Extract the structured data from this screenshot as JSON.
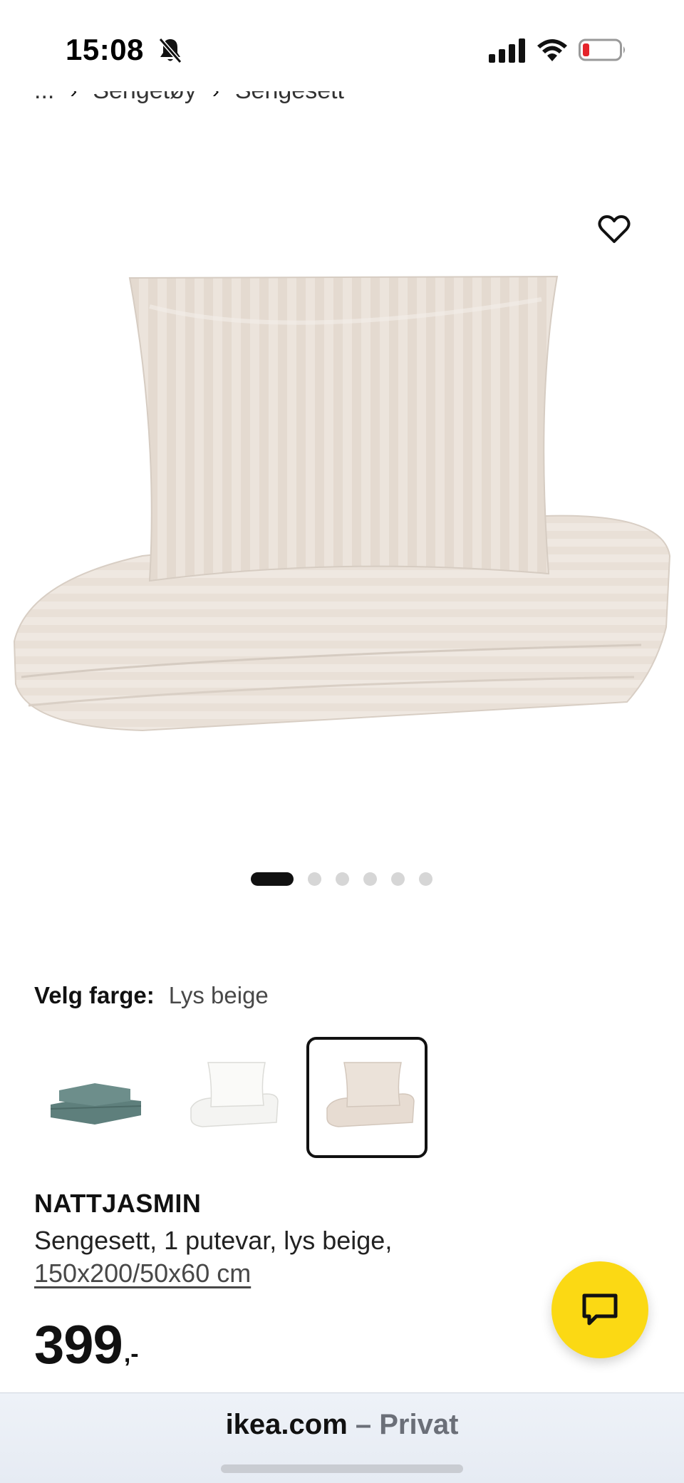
{
  "status_bar": {
    "time": "15:08",
    "icons": [
      "bell-slash-icon",
      "cellular-signal-icon",
      "wifi-icon",
      "battery-low-icon"
    ]
  },
  "breadcrumb": {
    "items": [
      "...",
      "Sengetøy",
      "Sengesett"
    ],
    "separator": "›"
  },
  "product": {
    "image_icon": "duvet-cover-pillowcase-image",
    "carousel": {
      "total": 6,
      "active_index": 0
    },
    "color_selector": {
      "label": "Velg farge:",
      "value": "Lys beige",
      "swatches": [
        {
          "name": "grønn",
          "color": "#5e7f7c"
        },
        {
          "name": "hvit",
          "color": "#f4f4f2"
        },
        {
          "name": "lys beige",
          "color": "#e7dcd2",
          "selected": true
        }
      ]
    },
    "name": "NATTJASMIN",
    "description": "Sengesett, 1 putevar, lys beige,",
    "size": "150x200/50x60 cm",
    "price": {
      "amount": "399",
      "suffix": ",-"
    }
  },
  "chat": {
    "icon": "chat-bubble-icon",
    "color": "#fbd914"
  },
  "browser": {
    "domain": "ikea.com",
    "mode": " – Privat"
  }
}
